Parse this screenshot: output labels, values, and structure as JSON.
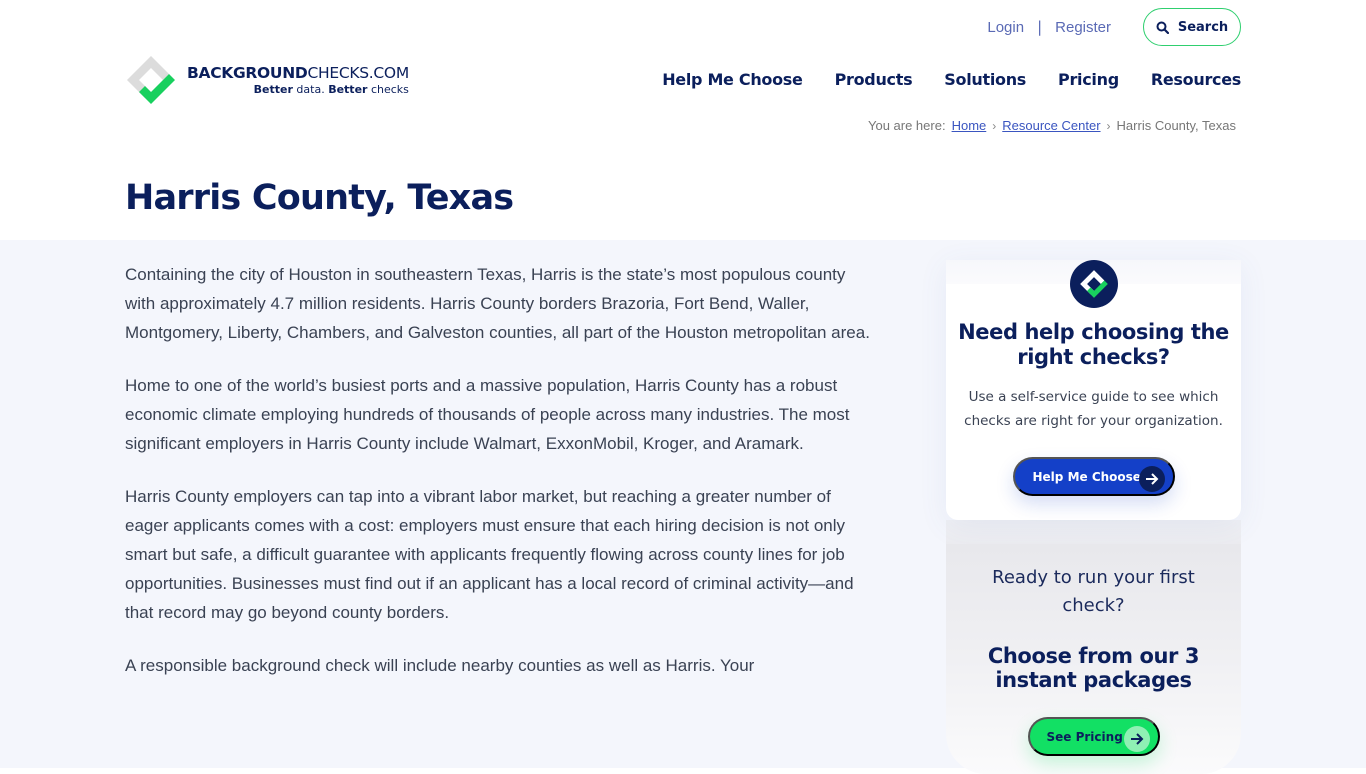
{
  "brand": {
    "name_bold": "BACKGROUND",
    "name_light": "CHECKS.COM",
    "tagline_part1": "Better",
    "tagline_part2": " data. ",
    "tagline_part3": "Better",
    "tagline_part4": " checks",
    "colors": {
      "navy": "#0b1f5c",
      "green": "#12e064",
      "blue": "#1440c8"
    }
  },
  "top_links": {
    "login": "Login",
    "separator": "|",
    "register": "Register",
    "search_label": "Search",
    "search_icon": "search-icon"
  },
  "nav": {
    "items": [
      "Help Me Choose",
      "Products",
      "Solutions",
      "Pricing",
      "Resources"
    ]
  },
  "breadcrumb": {
    "label": "You are here:",
    "items": [
      "Home",
      "Resource Center",
      "Harris County, Texas"
    ],
    "separator": "›"
  },
  "page": {
    "title": "Harris County, Texas"
  },
  "article": {
    "paragraphs": [
      "Containing the city of Houston in southeastern Texas, Harris is the state’s most populous county with approximately 4.7 million residents. Harris County borders Brazoria, Fort Bend, Waller, Montgomery, Liberty, Chambers, and Galveston counties, all part of the Houston metropolitan area.",
      "Home to one of the world’s busiest ports and a massive population, Harris County has a robust economic climate employing hundreds of thousands of people across many industries. The most significant employers in Harris County include Walmart, ExxonMobil, Kroger, and Aramark.",
      "Harris County employers can tap into a vibrant labor market, but reaching a greater number of eager applicants comes with a cost: employers must ensure that each hiring decision is not only smart but safe, a difficult guarantee with applicants frequently flowing across county lines for job opportunities. Businesses must find out if an applicant has a local record of criminal activity—and that record may go beyond county borders.",
      "A responsible background check will include nearby counties as well as Harris. Your"
    ]
  },
  "sidebar": {
    "help_card": {
      "icon": "brand-check-icon",
      "title": "Need help choosing the right checks?",
      "text": "Use a self-service guide to see which checks are right for your organization.",
      "button_label": "Help Me Choose",
      "button_icon": "arrow-right-icon"
    },
    "pricing_card": {
      "question": "Ready to run your first check?",
      "title": "Choose from our 3 instant packages",
      "button_label": "See Pricing",
      "button_icon": "arrow-right-icon"
    }
  }
}
